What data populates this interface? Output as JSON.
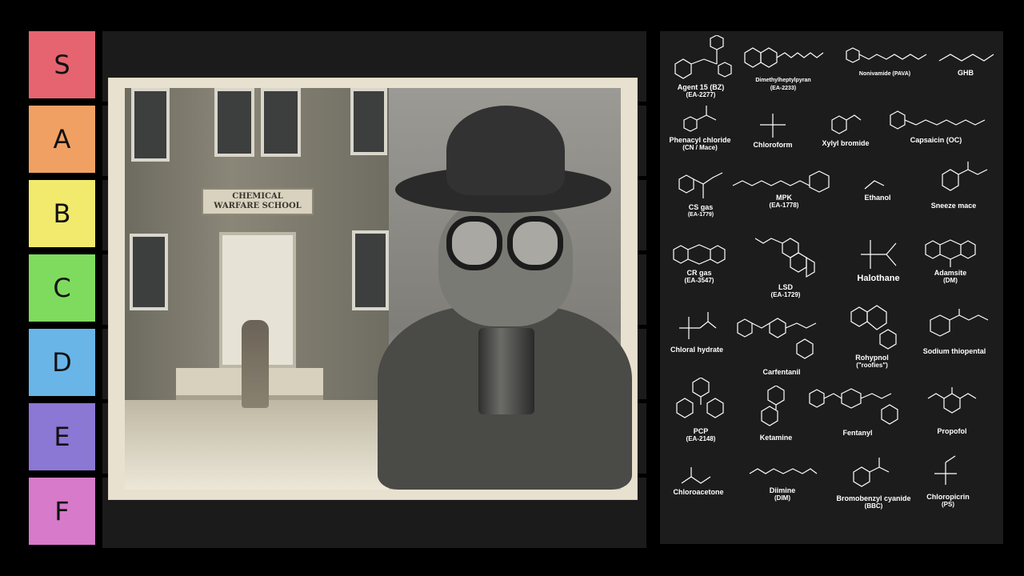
{
  "tiers": [
    {
      "label": "S",
      "color": "#e5646f"
    },
    {
      "label": "A",
      "color": "#f0a063"
    },
    {
      "label": "B",
      "color": "#f1ea6c"
    },
    {
      "label": "C",
      "color": "#7fdb5d"
    },
    {
      "label": "D",
      "color": "#69b5e8"
    },
    {
      "label": "E",
      "color": "#8b77d4"
    },
    {
      "label": "F",
      "color": "#d67ac9"
    }
  ],
  "photo": {
    "sign_line1": "CHEMICAL",
    "sign_line2": "WARFARE SCHOOL"
  },
  "chemicals": [
    {
      "name": "Agent 15 (BZ)",
      "sub": "(EA-2277)",
      "icon": "benzilate-structure"
    },
    {
      "name": "Dimethylheptylpyran",
      "sub": "(EA-2233)",
      "icon": "cannabinoid-structure"
    },
    {
      "name": "Nonivamide (PAVA)",
      "sub": "",
      "icon": "capsaicinoid-structure"
    },
    {
      "name": "GHB",
      "sub": "",
      "icon": "hydroxybutyrate-structure"
    },
    {
      "name": "Phenacyl chloride",
      "sub": "(CN / Mace)",
      "icon": "ketone-structure"
    },
    {
      "name": "Chloroform",
      "sub": "",
      "icon": "trichloromethane-structure"
    },
    {
      "name": "Xylyl bromide",
      "sub": "",
      "icon": "benzyl-bromide-structure"
    },
    {
      "name": "Capsaicin (OC)",
      "sub": "",
      "icon": "capsaicin-structure"
    },
    {
      "name": "CS gas",
      "sub": "(EA-1779)",
      "icon": "malononitrile-structure"
    },
    {
      "name": "MPK",
      "sub": "(EA-1778)",
      "icon": "morpholine-ketone-structure"
    },
    {
      "name": "Ethanol",
      "sub": "",
      "icon": "ethanol-structure"
    },
    {
      "name": "Sneeze mace",
      "sub": "",
      "icon": "catechol-ketone-structure"
    },
    {
      "name": "CR gas",
      "sub": "(EA-3547)",
      "icon": "dibenzoxazepine-structure"
    },
    {
      "name": "LSD",
      "sub": "(EA-1729)",
      "icon": "ergoline-structure"
    },
    {
      "name": "Halothane",
      "sub": "",
      "icon": "haloalkane-structure"
    },
    {
      "name": "Adamsite",
      "sub": "(DM)",
      "icon": "phenarsazine-structure"
    },
    {
      "name": "Chloral hydrate",
      "sub": "",
      "icon": "chloral-structure"
    },
    {
      "name": "Carfentanil",
      "sub": "",
      "icon": "piperidine-structure"
    },
    {
      "name": "Rohypnol",
      "sub": "(\"roofies\")",
      "icon": "benzodiazepine-structure"
    },
    {
      "name": "Sodium thiopental",
      "sub": "",
      "icon": "barbiturate-structure"
    },
    {
      "name": "PCP",
      "sub": "(EA-2148)",
      "icon": "cyclohexylpiperidine-structure"
    },
    {
      "name": "Ketamine",
      "sub": "",
      "icon": "arylcyclohexylamine-structure"
    },
    {
      "name": "Fentanyl",
      "sub": "",
      "icon": "anilidopiperidine-structure"
    },
    {
      "name": "Propofol",
      "sub": "",
      "icon": "phenol-structure"
    },
    {
      "name": "Chloroacetone",
      "sub": "",
      "icon": "chloroketone-structure"
    },
    {
      "name": "Diimine",
      "sub": "(DIM)",
      "icon": "diimine-structure"
    },
    {
      "name": "Bromobenzyl cyanide",
      "sub": "(BBC)",
      "icon": "nitrile-structure"
    },
    {
      "name": "Chloropicrin",
      "sub": "(PS)",
      "icon": "nitro-structure"
    }
  ]
}
